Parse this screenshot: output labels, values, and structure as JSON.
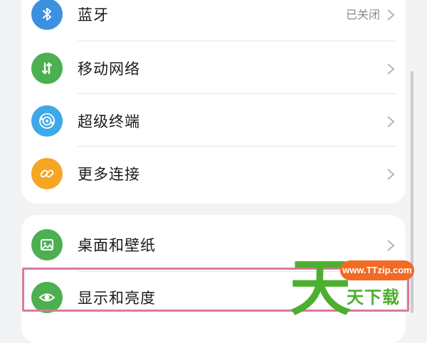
{
  "connectivity_group": {
    "items": [
      {
        "label": "蓝牙",
        "status": "已关闭",
        "icon": "bluetooth-icon",
        "color": "#3d8fe0"
      },
      {
        "label": "移动网络",
        "status": "",
        "icon": "mobile-data-icon",
        "color": "#4caf50"
      },
      {
        "label": "超级终端",
        "status": "",
        "icon": "super-device-icon",
        "color": "#3fa9e8"
      },
      {
        "label": "更多连接",
        "status": "",
        "icon": "link-icon",
        "color": "#f5a623"
      }
    ]
  },
  "display_group": {
    "items": [
      {
        "label": "桌面和壁纸",
        "status": "",
        "icon": "wallpaper-icon",
        "color": "#4caf50"
      },
      {
        "label": "显示和亮度",
        "status": "",
        "icon": "eye-icon",
        "color": "#4caf50"
      }
    ]
  },
  "watermark": {
    "url": "www.TTzip.com",
    "text": "天下载",
    "bubble_color": "#f26a23",
    "text_color": "#4caf2f"
  }
}
